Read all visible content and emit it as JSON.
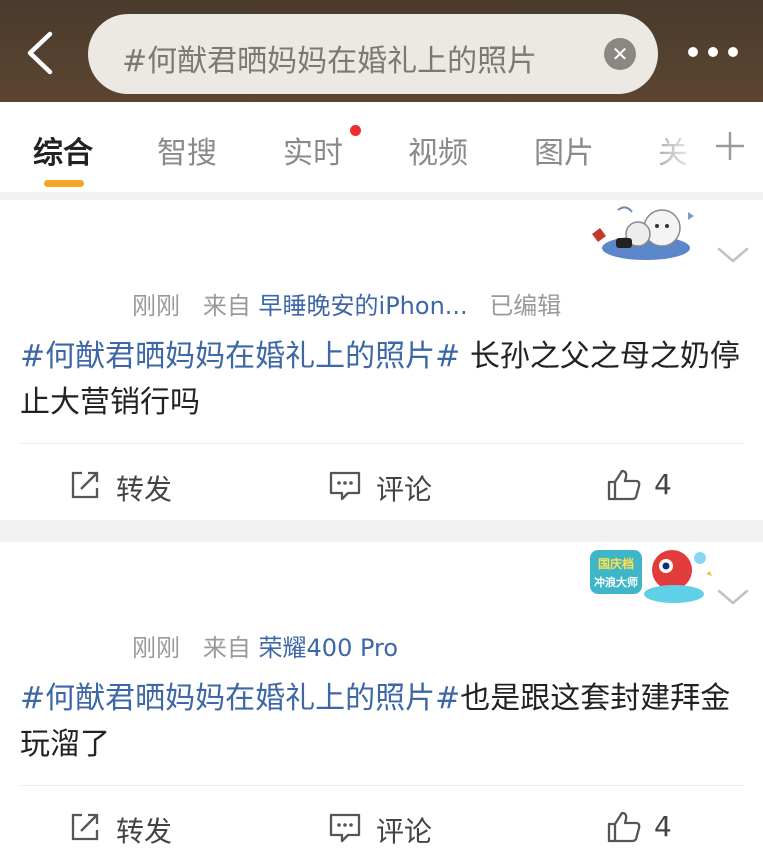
{
  "search": {
    "query": "#何猷君晒妈妈在婚礼上的照片",
    "clear_icon": "clear-icon",
    "back_icon": "back-arrow-icon",
    "more_icon": "more-dots-icon"
  },
  "tabs": [
    {
      "label": "综合",
      "active": true
    },
    {
      "label": "智搜"
    },
    {
      "label": "实时",
      "badge": "red-dot"
    },
    {
      "label": "视频"
    },
    {
      "label": "图片"
    },
    {
      "label": "关"
    }
  ],
  "posts": [
    {
      "time": "刚刚",
      "from_prefix": "来自",
      "source": "早睡晚安的iPhon...",
      "edited": "已编辑",
      "tag": "#何猷君晒妈妈在婚礼上的照片#",
      "text": " 长孙之父之母之奶停止大营销行吗",
      "repost": "转发",
      "comment": "评论",
      "likes": "4"
    },
    {
      "time": "刚刚",
      "from_prefix": "来自",
      "source": "荣耀400 Pro",
      "sticker_text_1": "国庆档",
      "sticker_text_2": "冲浪大师",
      "tag": "#何猷君晒妈妈在婚礼上的照片#",
      "text": "也是跟这套封建拜金玩溜了",
      "repost": "转发",
      "comment": "评论",
      "likes": "4"
    }
  ],
  "colors": {
    "topbar": "#4a3a2b",
    "accent": "#f5a623",
    "link": "#3d67a6",
    "badge": "#f02d2d"
  }
}
